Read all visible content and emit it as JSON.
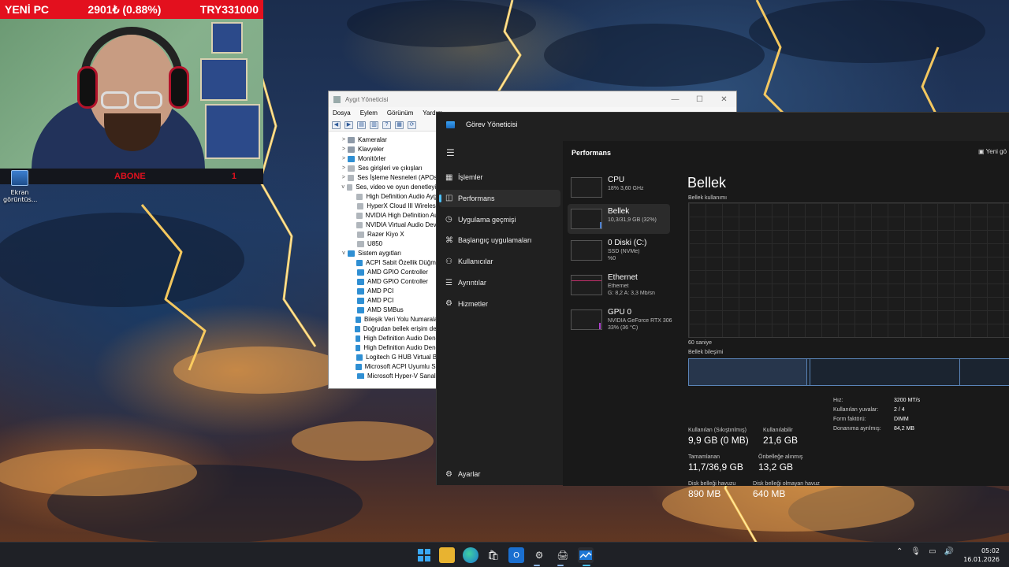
{
  "ticker": {
    "name": "YENİ PC",
    "price": "2901₺ (0.88%)",
    "target": "TRY331000"
  },
  "abone": {
    "label": "ABONE",
    "count": "1"
  },
  "desktop_icon": {
    "label": "Ekran görüntüs..."
  },
  "device_manager": {
    "title": "Aygıt Yöneticisi",
    "menu": [
      "Dosya",
      "Eylem",
      "Görünüm",
      "Yardım"
    ],
    "tree": [
      {
        "expander": ">",
        "label": "Kameralar",
        "indent": 0,
        "kind": "cat"
      },
      {
        "expander": ">",
        "label": "Klavyeler",
        "indent": 0,
        "kind": "cat"
      },
      {
        "expander": ">",
        "label": "Monitörler",
        "indent": 0,
        "kind": "sys"
      },
      {
        "expander": ">",
        "label": "Ses girişleri ve çıkışları",
        "indent": 0,
        "kind": "snd"
      },
      {
        "expander": ">",
        "label": "Ses İşleme Nesneleri (APOs)",
        "indent": 0,
        "kind": "snd"
      },
      {
        "expander": "v",
        "label": "Ses, video ve oyun denetleyicileri",
        "indent": 0,
        "kind": "snd"
      },
      {
        "expander": "",
        "label": "High Definition Audio Aygıtı",
        "indent": 1,
        "kind": "snd"
      },
      {
        "expander": "",
        "label": "HyperX Cloud III Wireless",
        "indent": 1,
        "kind": "snd"
      },
      {
        "expander": "",
        "label": "NVIDIA High Definition Audio",
        "indent": 1,
        "kind": "snd"
      },
      {
        "expander": "",
        "label": "NVIDIA Virtual Audio Device",
        "indent": 1,
        "kind": "snd"
      },
      {
        "expander": "",
        "label": "Razer Kiyo X",
        "indent": 1,
        "kind": "snd"
      },
      {
        "expander": "",
        "label": "U850",
        "indent": 1,
        "kind": "snd"
      },
      {
        "expander": "v",
        "label": "Sistem aygıtları",
        "indent": 0,
        "kind": "sys"
      },
      {
        "expander": "",
        "label": "ACPI Sabit Özellik Düğmesi",
        "indent": 1,
        "kind": "sys"
      },
      {
        "expander": "",
        "label": "AMD GPIO Controller",
        "indent": 1,
        "kind": "sys"
      },
      {
        "expander": "",
        "label": "AMD GPIO Controller",
        "indent": 1,
        "kind": "sys"
      },
      {
        "expander": "",
        "label": "AMD PCI",
        "indent": 1,
        "kind": "sys"
      },
      {
        "expander": "",
        "label": "AMD PCI",
        "indent": 1,
        "kind": "sys"
      },
      {
        "expander": "",
        "label": "AMD SMBus",
        "indent": 1,
        "kind": "sys"
      },
      {
        "expander": "",
        "label": "Bileşik Veri Yolu Numaralandırıcı",
        "indent": 1,
        "kind": "sys"
      },
      {
        "expander": "",
        "label": "Doğrudan bellek erişim denetleyicisi",
        "indent": 1,
        "kind": "sys"
      },
      {
        "expander": "",
        "label": "High Definition Audio Denetleyicisi",
        "indent": 1,
        "kind": "sys"
      },
      {
        "expander": "",
        "label": "High Definition Audio Denetleyicisi",
        "indent": 1,
        "kind": "sys"
      },
      {
        "expander": "",
        "label": "Logitech G HUB Virtual Bus",
        "indent": 1,
        "kind": "sys"
      },
      {
        "expander": "",
        "label": "Microsoft ACPI Uyumlu Sistem",
        "indent": 1,
        "kind": "sys"
      },
      {
        "expander": "",
        "label": "Microsoft Hyper-V Sanal",
        "indent": 1,
        "kind": "sys"
      }
    ]
  },
  "task_manager": {
    "title": "Görev Yöneticisi",
    "nav": [
      {
        "label": "İşlemler",
        "icon": "processes-icon",
        "glyph": "▦",
        "active": false
      },
      {
        "label": "Performans",
        "icon": "performance-icon",
        "glyph": "◫",
        "active": true
      },
      {
        "label": "Uygulama geçmişi",
        "icon": "history-icon",
        "glyph": "◷",
        "active": false
      },
      {
        "label": "Başlangıç uygulamaları",
        "icon": "startup-icon",
        "glyph": "⌘",
        "active": false
      },
      {
        "label": "Kullanıcılar",
        "icon": "users-icon",
        "glyph": "⚇",
        "active": false
      },
      {
        "label": "Ayrıntılar",
        "icon": "details-icon",
        "glyph": "☰",
        "active": false
      },
      {
        "label": "Hizmetler",
        "icon": "services-icon",
        "glyph": "⚙",
        "active": false
      }
    ],
    "settings_label": "Ayarlar",
    "page_title": "Performans",
    "new_task": "Yeni gö",
    "perf_items": [
      {
        "name": "CPU",
        "sub1": "18% 3,60 GHz",
        "sub2": "",
        "active": false
      },
      {
        "name": "Bellek",
        "sub1": "10,3/31,9 GB (32%)",
        "sub2": "",
        "active": true
      },
      {
        "name": "0 Diski (C:)",
        "sub1": "SSD (NVMe)",
        "sub2": "%0",
        "active": false
      },
      {
        "name": "Ethernet",
        "sub1": "Ethernet",
        "sub2": "G: 8,2 A: 3,3 Mb/sn",
        "active": false
      },
      {
        "name": "GPU 0",
        "sub1": "NVIDIA GeForce RTX 306",
        "sub2": "33% (36 °C)",
        "active": false
      }
    ],
    "memory": {
      "title": "Bellek",
      "usage_label": "Bellek kullanımı",
      "time_label": "60 saniye",
      "composition_label": "Bellek bileşimi",
      "in_use_fraction": 0.32,
      "stats": [
        {
          "label": "Kullanılan (Sıkıştırılmış)",
          "value": "9,9 GB (0 MB)"
        },
        {
          "label": "Kullanılabilir",
          "value": "21,6 GB"
        },
        {
          "label": "Tamamlanan",
          "value": "11,7/36,9 GB"
        },
        {
          "label": "Önbelleğe alınmış",
          "value": "13,2 GB"
        },
        {
          "label": "Disk belleği havuzu",
          "value": "890 MB"
        },
        {
          "label": "Disk belleği olmayan havuz",
          "value": "640 MB"
        }
      ],
      "specs": [
        {
          "key": "Hız:",
          "value": "3200 MT/s"
        },
        {
          "key": "Kullanılan yuvalar:",
          "value": "2 / 4"
        },
        {
          "key": "Form faktörü:",
          "value": "DIMM"
        },
        {
          "key": "Donanıma ayrılmış:",
          "value": "84,2 MB"
        }
      ]
    }
  },
  "taskbar": {
    "time": "05:02",
    "date": "16.01.2026"
  },
  "colors": {
    "accent": "#4cc2ff",
    "ticker_bg": "#e3101e",
    "tm_bg": "#202020"
  }
}
